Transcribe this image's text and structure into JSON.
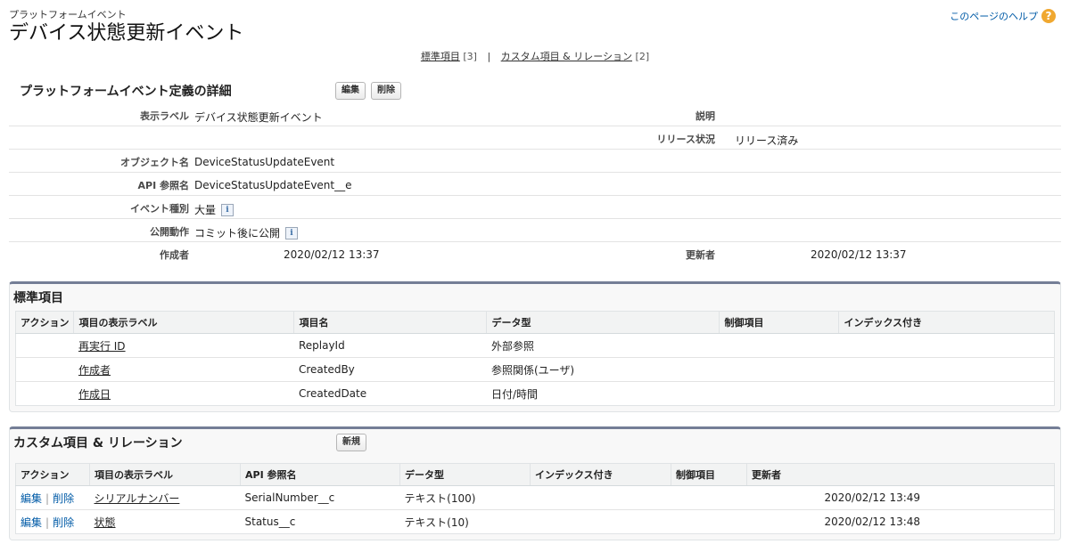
{
  "header": {
    "type_label": "プラットフォームイベント",
    "title": "デバイス状態更新イベント",
    "help_link": "このページのヘルプ",
    "help_icon": "?"
  },
  "related_links": [
    {
      "label": "標準項目",
      "count": "[3]"
    },
    {
      "label": "カスタム項目 & リレーション",
      "count": "[2]"
    }
  ],
  "related_links_separator": "|",
  "detail": {
    "title": "プラットフォームイベント定義の詳細",
    "edit_button": "編集",
    "delete_button": "削除",
    "rows": [
      {
        "label": "表示ラベル",
        "value": "デバイス状態更新イベント",
        "right_label": "説明",
        "right_value": ""
      },
      {
        "label": "",
        "value": "",
        "right_label": "リリース状況",
        "right_value": "リリース済み"
      },
      {
        "label": "オブジェクト名",
        "value": "DeviceStatusUpdateEvent"
      },
      {
        "label": "API 参照名",
        "value": "DeviceStatusUpdateEvent__e"
      },
      {
        "label": "イベント種別",
        "value": "大量",
        "info": "i"
      },
      {
        "label": "公開動作",
        "value": "コミット後に公開",
        "info": "i"
      },
      {
        "label": "作成者",
        "value": "2020/02/12 13:37",
        "right_label": "更新者",
        "right_value": "2020/02/12 13:37"
      }
    ]
  },
  "standard_fields": {
    "title": "標準項目",
    "columns": [
      "アクション",
      "項目の表示ラベル",
      "項目名",
      "データ型",
      "制御項目",
      "インデックス付き"
    ],
    "rows": [
      {
        "label": "再実行 ID",
        "name": "ReplayId",
        "type": "外部参照"
      },
      {
        "label": "作成者",
        "name": "CreatedBy",
        "type": "参照関係(ユーザ)"
      },
      {
        "label": "作成日",
        "name": "CreatedDate",
        "type": "日付/時間"
      }
    ]
  },
  "custom_fields": {
    "title": "カスタム項目 & リレーション",
    "new_button": "新規",
    "columns": [
      "アクション",
      "項目の表示ラベル",
      "API 参照名",
      "データ型",
      "インデックス付き",
      "制御項目",
      "更新者"
    ],
    "rows": [
      {
        "edit": "編集",
        "delete": "削除",
        "label": "シリアルナンバー",
        "api": "SerialNumber__c",
        "type": "テキスト(100)",
        "modified": "2020/02/12 13:49"
      },
      {
        "edit": "編集",
        "delete": "削除",
        "label": "状態",
        "api": "Status__c",
        "type": "テキスト(10)",
        "modified": "2020/02/12 13:48"
      }
    ]
  }
}
